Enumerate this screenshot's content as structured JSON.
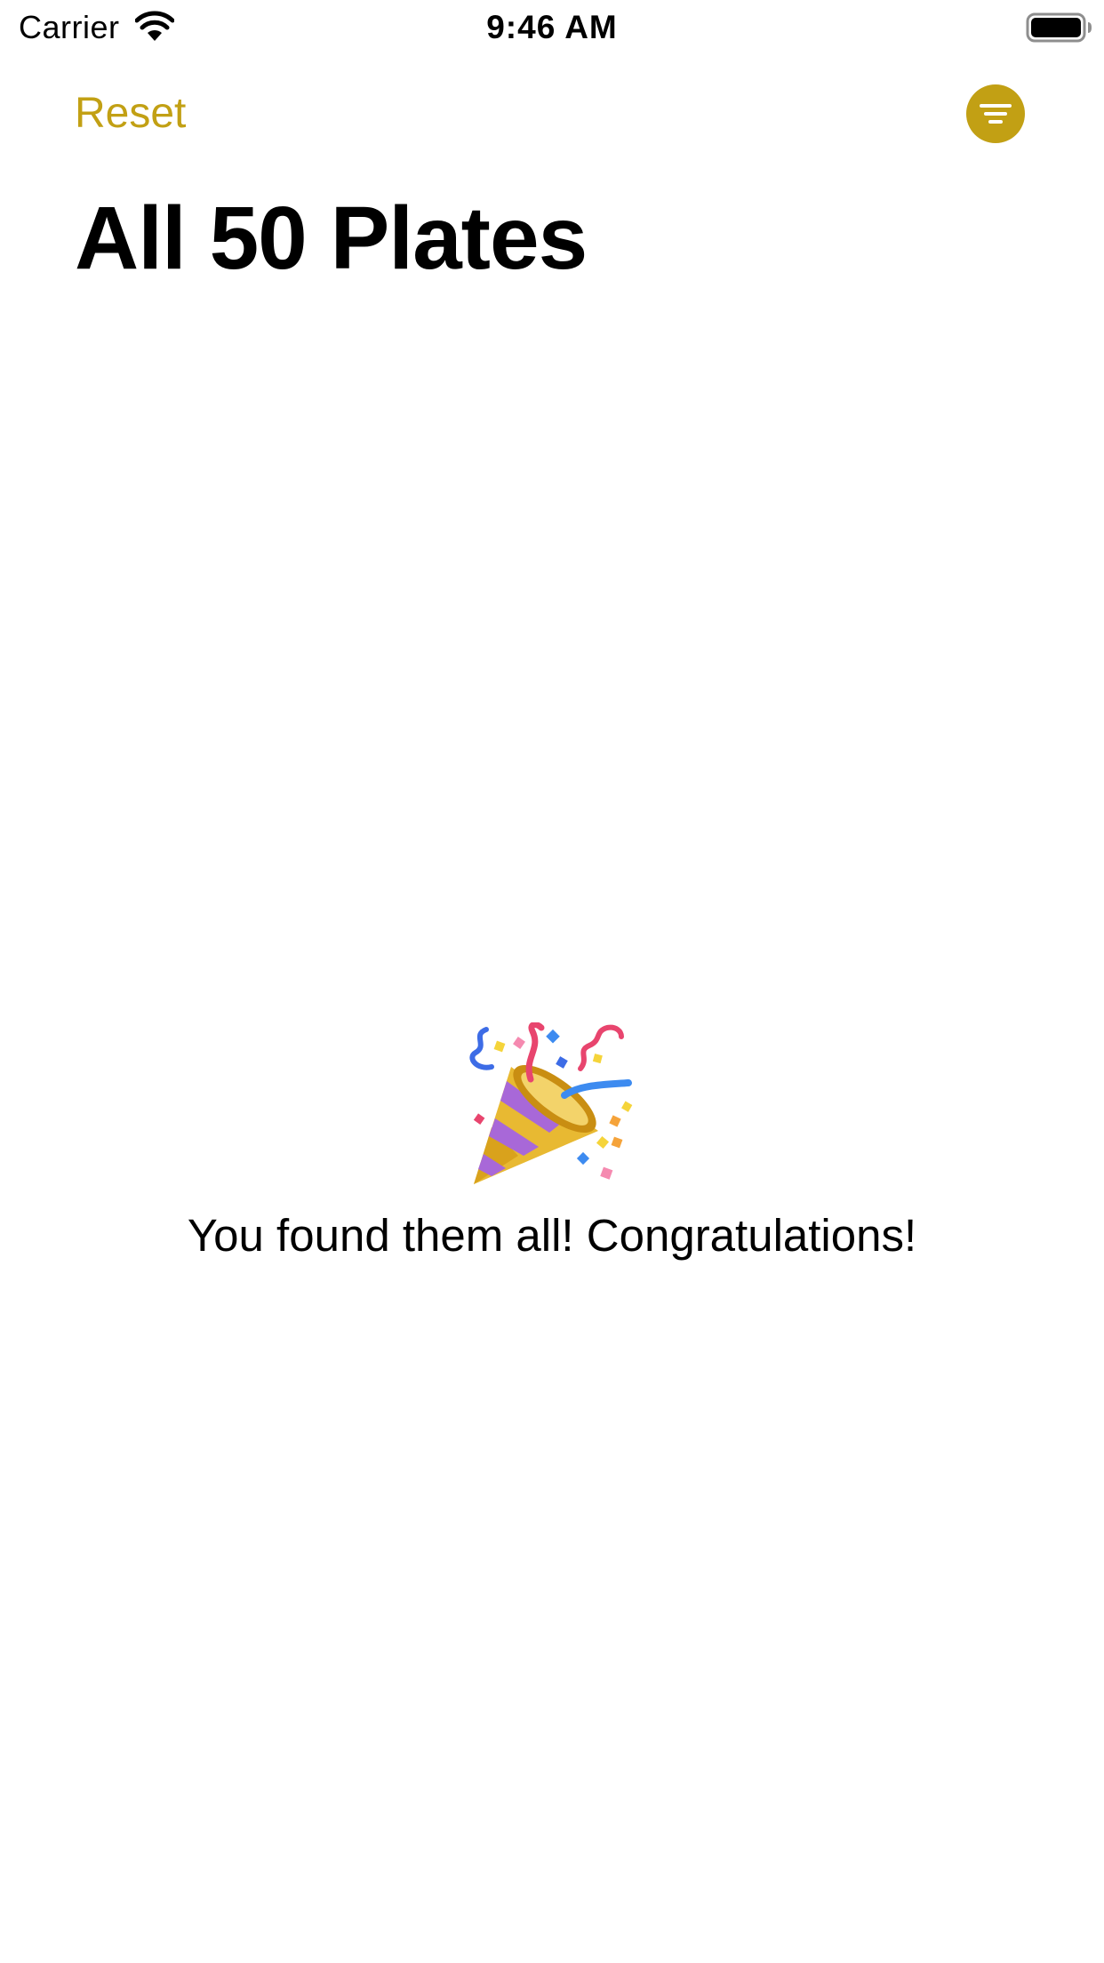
{
  "status_bar": {
    "carrier": "Carrier",
    "time": "9:46 AM",
    "icons": [
      "wifi-icon",
      "battery-icon"
    ]
  },
  "nav": {
    "reset_label": "Reset",
    "filter_icon": "filter-icon",
    "accent_color": "#C2A014"
  },
  "page": {
    "title": "All 50 Plates"
  },
  "empty_state": {
    "icon": "party-popper-icon",
    "message": "You found them all! Congratulations!"
  }
}
